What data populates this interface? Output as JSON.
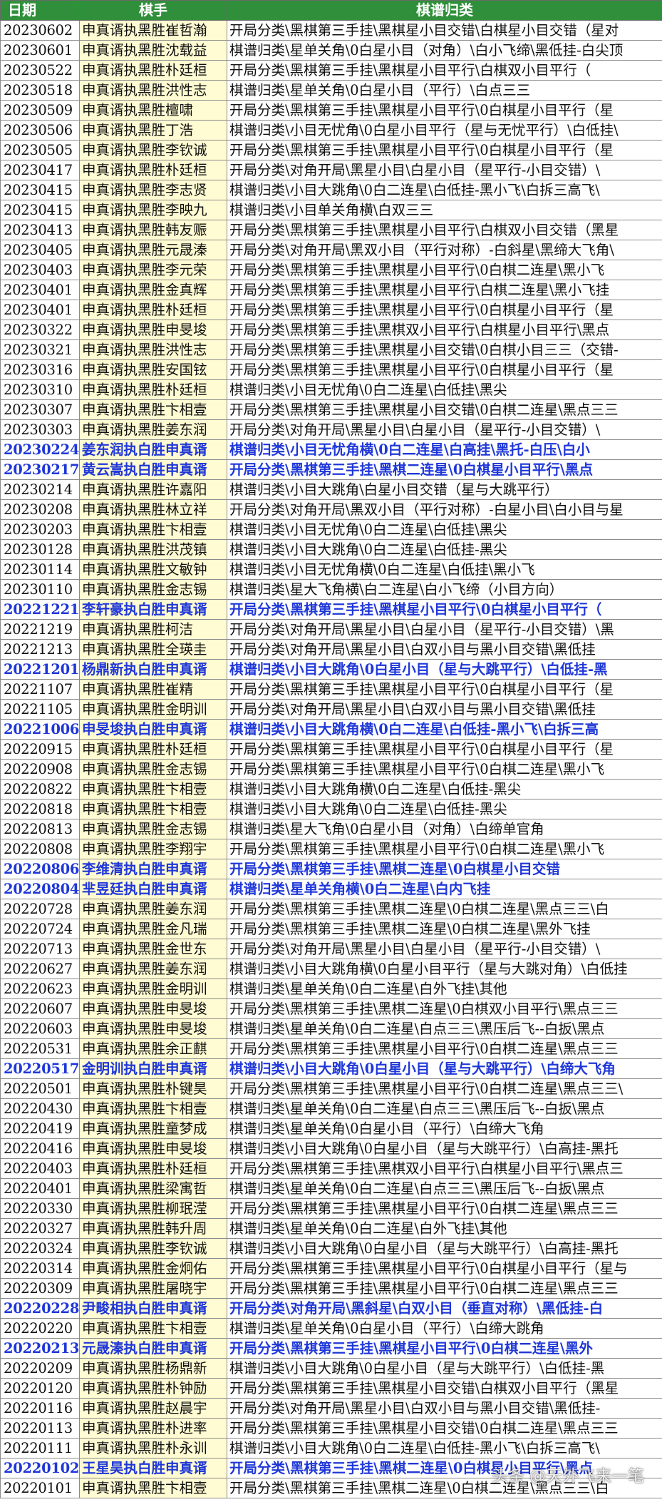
{
  "header": {
    "date": "日期",
    "player": "棋手",
    "class": "棋谱归类"
  },
  "rows": [
    {
      "date": "20230602",
      "player": "申真谞执黑胜崔哲瀚",
      "class": "开局分类\\黑棋第三手挂\\黑棋星小目交错\\白棋星小目交错（星对",
      "hl": false
    },
    {
      "date": "20230601",
      "player": "申真谞执黑胜沈载益",
      "class": "棋谱归类\\星单关角\\0白星小目（对角）\\白小飞缔\\黑低挂-白尖顶",
      "hl": false
    },
    {
      "date": "20230522",
      "player": "申真谞执黑胜朴廷桓",
      "class": "开局分类\\黑棋第三手挂\\黑棋星小目平行\\白棋双小目平行（",
      "hl": false
    },
    {
      "date": "20230518",
      "player": "申真谞执黑胜洪性志",
      "class": "棋谱归类\\星单关角\\0白星小目（平行）\\白点三三",
      "hl": false
    },
    {
      "date": "20230509",
      "player": "申真谞执黑胜檀啸",
      "class": "开局分类\\黑棋第三手挂\\黑棋星小目平行\\0白棋星小目平行（星",
      "hl": false
    },
    {
      "date": "20230506",
      "player": "申真谞执黑胜丁浩",
      "class": "棋谱归类\\小目无忧角\\0白星小目平行（星与无忧平行）\\白低挂\\",
      "hl": false
    },
    {
      "date": "20230505",
      "player": "申真谞执黑胜李钦诚",
      "class": "开局分类\\黑棋第三手挂\\黑棋星小目平行\\0白棋星小目平行（星",
      "hl": false
    },
    {
      "date": "20230417",
      "player": "申真谞执黑胜朴廷桓",
      "class": "开局分类\\对角开局\\黑星小目\\白星小目（星平行-小目交错）\\",
      "hl": false
    },
    {
      "date": "20230415",
      "player": "申真谞执黑胜李志贤",
      "class": "棋谱归类\\小目大跳角\\0白二连星\\白低挂-黑小飞\\白拆三高飞\\",
      "hl": false
    },
    {
      "date": "20230415",
      "player": "申真谞执黑胜李映九",
      "class": "棋谱归类\\小目单关角横\\白双三三",
      "hl": false
    },
    {
      "date": "20230413",
      "player": "申真谞执黑胜韩友赈",
      "class": "开局分类\\黑棋第三手挂\\黑棋星小目平行\\白棋双小目交错（黑星",
      "hl": false
    },
    {
      "date": "20230405",
      "player": "申真谞执黑胜元晟溱",
      "class": "开局分类\\对角开局\\黑双小目（平行对称）-白斜星\\黑缔大飞角\\",
      "hl": false
    },
    {
      "date": "20230403",
      "player": "申真谞执黑胜李元荣",
      "class": "开局分类\\黑棋第三手挂\\黑棋星小目平行\\0白棋二连星\\黑小飞",
      "hl": false
    },
    {
      "date": "20230401",
      "player": "申真谞执黑胜金真辉",
      "class": "开局分类\\黑棋第三手挂\\黑棋星小目平行\\白棋二连星\\黑小飞挂",
      "hl": false
    },
    {
      "date": "20230401",
      "player": "申真谞执黑胜朴廷桓",
      "class": "开局分类\\黑棋第三手挂\\黑棋星小目平行\\0白棋星小目平行（星",
      "hl": false
    },
    {
      "date": "20230322",
      "player": "申真谞执黑胜申旻埈",
      "class": "开局分类\\黑棋第三手挂\\黑棋双小目平行\\白棋星小目平行\\黑点",
      "hl": false
    },
    {
      "date": "20230321",
      "player": "申真谞执黑胜洪性志",
      "class": "开局分类\\黑棋第三手挂\\黑棋星小目交错\\0白棋小目三三（交错-",
      "hl": false
    },
    {
      "date": "20230316",
      "player": "申真谞执黑胜安国铉",
      "class": "开局分类\\黑棋第三手挂\\黑棋星小目平行\\0白棋星小目平行（星",
      "hl": false
    },
    {
      "date": "20230310",
      "player": "申真谞执黑胜朴廷桓",
      "class": "棋谱归类\\小目无忧角\\0白二连星\\白低挂\\黑尖",
      "hl": false
    },
    {
      "date": "20230307",
      "player": "申真谞执黑胜卞相壹",
      "class": "开局分类\\黑棋第三手挂\\黑棋星小目交错\\0白棋二连星\\黑点三三",
      "hl": false
    },
    {
      "date": "20230303",
      "player": "申真谞执黑胜姜东润",
      "class": "开局分类\\对角开局\\黑星小目\\白星小目（星平行-小目交错）\\",
      "hl": false
    },
    {
      "date": "20230224",
      "player": "姜东润执白胜申真谞",
      "class": "棋谱归类\\小目无忧角横\\0白二连星\\白高挂\\黑托-白压\\白小",
      "hl": true
    },
    {
      "date": "20230217",
      "player": "黄云嵩执白胜申真谞",
      "class": "开局分类\\黑棋第三手挂\\黑棋二连星\\0白棋星小目平行\\黑点",
      "hl": true
    },
    {
      "date": "20230214",
      "player": "申真谞执黑胜许嘉阳",
      "class": "棋谱归类\\小目大跳角\\白星小目交错（星与大跳平行）",
      "hl": false
    },
    {
      "date": "20230208",
      "player": "申真谞执黑胜林立祥",
      "class": "开局分类\\对角开局\\黑双小目（平行对称）-白星小目\\白小目与星",
      "hl": false
    },
    {
      "date": "20230203",
      "player": "申真谞执黑胜卞相壹",
      "class": "棋谱归类\\小目无忧角\\0白二连星\\白低挂\\黑尖",
      "hl": false
    },
    {
      "date": "20230128",
      "player": "申真谞执黑胜洪茂镇",
      "class": "棋谱归类\\小目大跳角\\0白二连星\\白低挂-黑尖",
      "hl": false
    },
    {
      "date": "20230114",
      "player": "申真谞执黑胜文敏钟",
      "class": "棋谱归类\\小目无忧角横\\0白二连星\\白低挂\\黑小飞",
      "hl": false
    },
    {
      "date": "20230110",
      "player": "申真谞执黑胜金志锡",
      "class": "棋谱归类\\星大飞角横\\白二连星\\白小飞缔（小目方向）",
      "hl": false
    },
    {
      "date": "20221221",
      "player": "李轩豪执白胜申真谞",
      "class": "开局分类\\黑棋第三手挂\\黑棋星小目平行\\0白棋星小目平行（",
      "hl": true
    },
    {
      "date": "20221219",
      "player": "申真谞执黑胜柯洁",
      "class": "开局分类\\对角开局\\黑星小目\\白星小目（星平行-小目交错）\\黑",
      "hl": false
    },
    {
      "date": "20221213",
      "player": "申真谞执黑胜全瑛圭",
      "class": "开局分类\\对角开局\\黑星小目\\白双小目与黑小目交错\\黑低挂",
      "hl": false
    },
    {
      "date": "20221201",
      "player": "杨鼎新执白胜申真谞",
      "class": "棋谱归类\\小目大跳角\\0白星小目（星与大跳平行）\\白低挂-黑",
      "hl": true
    },
    {
      "date": "20221107",
      "player": "申真谞执黑胜崔精",
      "class": "开局分类\\黑棋第三手挂\\黑棋星小目平行\\0白棋星小目平行（星",
      "hl": false
    },
    {
      "date": "20221105",
      "player": "申真谞执黑胜金明训",
      "class": "开局分类\\对角开局\\黑星小目\\白双小目与黑小目交错\\黑低挂",
      "hl": false
    },
    {
      "date": "20221006",
      "player": "申旻埈执白胜申真谞",
      "class": "棋谱归类\\小目大跳角横\\0白二连星\\白低挂-黑小飞\\白拆三高",
      "hl": true
    },
    {
      "date": "20220915",
      "player": "申真谞执黑胜朴廷桓",
      "class": "开局分类\\黑棋第三手挂\\黑棋星小目平行\\0白棋星小目平行（星",
      "hl": false
    },
    {
      "date": "20220908",
      "player": "申真谞执黑胜金志锡",
      "class": "开局分类\\黑棋第三手挂\\黑棋星小目平行\\0白棋二连星\\黑小飞",
      "hl": false
    },
    {
      "date": "20220822",
      "player": "申真谞执黑胜卞相壹",
      "class": "棋谱归类\\小目大跳角横\\0白二连星\\白低挂-黑尖",
      "hl": false
    },
    {
      "date": "20220818",
      "player": "申真谞执黑胜卞相壹",
      "class": "棋谱归类\\小目大跳角\\0白二连星\\白低挂-黑尖",
      "hl": false
    },
    {
      "date": "20220813",
      "player": "申真谞执黑胜金志锡",
      "class": "棋谱归类\\星大飞角\\0白星小目（对角）\\白缔单官角",
      "hl": false
    },
    {
      "date": "20220808",
      "player": "申真谞执黑胜李翔宇",
      "class": "开局分类\\黑棋第三手挂\\黑棋星小目平行\\0白棋二连星\\黑小飞",
      "hl": false
    },
    {
      "date": "20220806",
      "player": "李维清执白胜申真谞",
      "class": "开局分类\\黑棋第三手挂\\黑棋二连星\\0白棋星小目交错",
      "hl": true
    },
    {
      "date": "20220804",
      "player": "芈昱廷执白胜申真谞",
      "class": "棋谱归类\\星单关角横\\0白二连星\\白内飞挂",
      "hl": true
    },
    {
      "date": "20220728",
      "player": "申真谞执黑胜姜东润",
      "class": "开局分类\\黑棋第三手挂\\黑棋二连星\\0白棋二连星\\黑点三三\\白",
      "hl": false
    },
    {
      "date": "20220724",
      "player": "申真谞执黑胜金凡瑞",
      "class": "开局分类\\黑棋第三手挂\\黑棋二连星\\0白棋二连星\\黑外飞挂",
      "hl": false
    },
    {
      "date": "20220713",
      "player": "申真谞执黑胜金世东",
      "class": "开局分类\\对角开局\\黑星小目\\白星小目（星平行-小目交错）\\",
      "hl": false
    },
    {
      "date": "20220627",
      "player": "申真谞执黑胜姜东润",
      "class": "棋谱归类\\小目大跳角横\\0白星小目平行（星与大跳对角）\\白低挂",
      "hl": false
    },
    {
      "date": "20220623",
      "player": "申真谞执黑胜金明训",
      "class": "棋谱归类\\星单关角\\0白二连星\\白外飞挂\\其他",
      "hl": false
    },
    {
      "date": "20220607",
      "player": "申真谞执黑胜申旻埈",
      "class": "开局分类\\黑棋第三手挂\\黑棋二连星\\0白棋双小目平行\\黑点三三",
      "hl": false
    },
    {
      "date": "20220603",
      "player": "申真谞执黑胜申旻埈",
      "class": "棋谱归类\\星单关角\\0白二连星\\白点三三\\黑压后飞--白扳\\黑点",
      "hl": false
    },
    {
      "date": "20220531",
      "player": "申真谞执黑胜余正麒",
      "class": "开局分类\\黑棋第三手挂\\黑棋星小目平行\\0白棋二连星\\黑点三三",
      "hl": false
    },
    {
      "date": "20220517",
      "player": "金明训执白胜申真谞",
      "class": "棋谱归类\\小目大跳角\\0白星小目（星与大跳平行）\\白缔大飞角",
      "hl": true
    },
    {
      "date": "20220501",
      "player": "申真谞执黑胜朴键昊",
      "class": "开局分类\\黑棋第三手挂\\黑棋星小目平行\\0白棋二连星\\黑点三三\\",
      "hl": false
    },
    {
      "date": "20220430",
      "player": "申真谞执黑胜卞相壹",
      "class": "棋谱归类\\星单关角\\0白二连星\\白点三三\\黑压后飞--白扳\\黑点",
      "hl": false
    },
    {
      "date": "20220419",
      "player": "申真谞执黑胜童梦成",
      "class": "棋谱归类\\星单关角\\0白星小目（平行）\\白缔大飞角",
      "hl": false
    },
    {
      "date": "20220416",
      "player": "申真谞执黑胜申旻埈",
      "class": "棋谱归类\\小目大跳角\\0白星小目（星与大跳平行）\\白高挂-黑托",
      "hl": false
    },
    {
      "date": "20220403",
      "player": "申真谞执黑胜朴廷桓",
      "class": "开局分类\\黑棋第三手挂\\黑棋双小目平行\\白棋星小目平行\\黑点三",
      "hl": false
    },
    {
      "date": "20220401",
      "player": "申真谞执黑胜梁寓哲",
      "class": "棋谱归类\\星单关角\\0白二连星\\白点三三\\黑压后飞--白扳\\黑点",
      "hl": false
    },
    {
      "date": "20220330",
      "player": "申真谞执黑胜柳珉滢",
      "class": "开局分类\\黑棋第三手挂\\黑棋星小目平行\\0白棋二连星\\黑点三三",
      "hl": false
    },
    {
      "date": "20220327",
      "player": "申真谞执黑胜韩升周",
      "class": "棋谱归类\\星单关角\\0白二连星\\白外飞挂\\其他",
      "hl": false
    },
    {
      "date": "20220324",
      "player": "申真谞执黑胜李钦诚",
      "class": "棋谱归类\\小目大跳角\\0白星小目（星与大跳平行）\\白高挂-黑托",
      "hl": false
    },
    {
      "date": "20220314",
      "player": "申真谞执黑胜金炯佑",
      "class": "开局分类\\黑棋第三手挂\\黑棋星小目平行\\0白棋星小目平行（星与",
      "hl": false
    },
    {
      "date": "20220309",
      "player": "申真谞执黑胜屠晓宇",
      "class": "开局分类\\黑棋第三手挂\\黑棋星小目平行\\0白棋二连星\\黑点三三",
      "hl": false
    },
    {
      "date": "20220228",
      "player": "尹畯相执白胜申真谞",
      "class": "开局分类\\对角开局\\黑斜星\\白双小目（垂直对称）\\黑低挂-白",
      "hl": true
    },
    {
      "date": "20220220",
      "player": "申真谞执黑胜卞相壹",
      "class": "棋谱归类\\星单关角\\0白星小目（平行）\\白缔大跳角",
      "hl": false
    },
    {
      "date": "20220213",
      "player": "元晟溱执白胜申真谞",
      "class": "开局分类\\黑棋第三手挂\\黑棋星小目平行\\0白棋二连星\\黑外",
      "hl": true
    },
    {
      "date": "20220209",
      "player": "申真谞执黑胜杨鼎新",
      "class": "棋谱归类\\小目大跳角\\0白星小目（星与大跳平行）\\白低挂-黑",
      "hl": false
    },
    {
      "date": "20220120",
      "player": "申真谞执黑胜朴钟励",
      "class": "开局分类\\黑棋第三手挂\\黑棋星小目交错\\白棋双小目平行（黑星",
      "hl": false
    },
    {
      "date": "20220116",
      "player": "申真谞执黑胜赵晨宇",
      "class": "开局分类\\对角开局\\黑星小目\\白双小目与黑小目交错\\黑低挂-",
      "hl": false
    },
    {
      "date": "20220113",
      "player": "申真谞执黑胜朴进率",
      "class": "开局分类\\黑棋第三手挂\\黑棋星小目交错\\0白棋二连星\\黑点三三",
      "hl": false
    },
    {
      "date": "20220111",
      "player": "申真谞执黑胜朴永训",
      "class": "棋谱归类\\小目大跳角\\0白二连星\\白低挂-黑小飞\\白拆三高飞\\",
      "hl": false
    },
    {
      "date": "20220102",
      "player": "王星昊执白胜申真谞",
      "class": "开局分类\\黑棋第三手挂\\黑棋二连星\\0白棋星小目平行\\黑点",
      "hl": true
    },
    {
      "date": "20220101",
      "player": "申真谞执黑胜卞相壹",
      "class": "开局分类\\黑棋第三手挂\\黑棋二连星\\0白棋二连星\\黑点三三\\白",
      "hl": false
    }
  ],
  "watermark": "头条 @天外飞来一笔"
}
